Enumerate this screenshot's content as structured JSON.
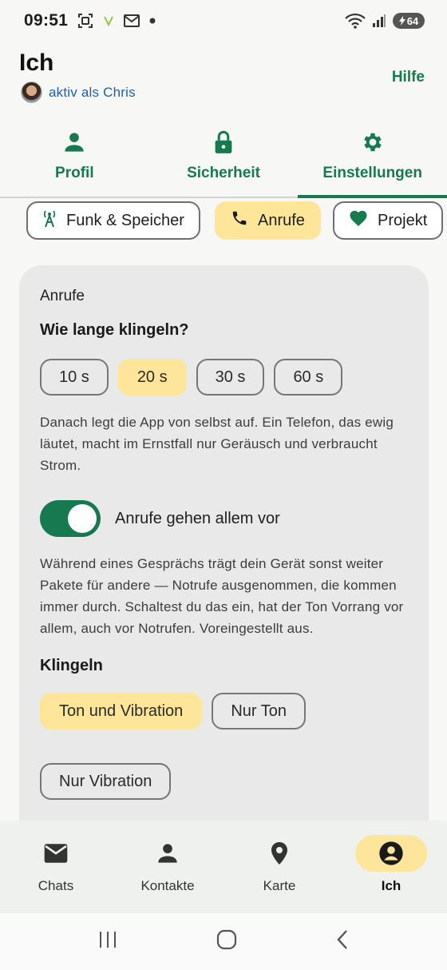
{
  "status_bar": {
    "time": "09:51",
    "battery": "64",
    "icons": [
      "screenshot-icon",
      "vpn-icon",
      "mail-icon",
      "dot-icon",
      "wifi-icon",
      "signal-icon",
      "battery-icon"
    ]
  },
  "header": {
    "title": "Ich",
    "user_status": "aktiv als Chris",
    "help_label": "Hilfe"
  },
  "tabs": [
    {
      "label": "Profil",
      "icon": "person-icon"
    },
    {
      "label": "Sicherheit",
      "icon": "lock-icon"
    },
    {
      "label": "Einstellungen",
      "icon": "gear-icon",
      "active": true
    }
  ],
  "chips": [
    {
      "label": "Funk & Speicher",
      "icon": "antenna-icon"
    },
    {
      "label": "Anrufe",
      "icon": "phone-icon",
      "selected": true
    },
    {
      "label": "Projekt",
      "icon": "heart-icon"
    }
  ],
  "calls": {
    "section_title": "Anrufe",
    "ring_duration_question": "Wie lange klingeln?",
    "ring_duration_options": [
      "10 s",
      "20 s",
      "30 s",
      "60 s"
    ],
    "ring_duration_selected": "20 s",
    "ring_duration_help": "Danach legt die App von selbst auf. Ein Telefon, das ewig läutet, macht im Ernstfall nur Geräusch und verbraucht Strom.",
    "priority_toggle_label": "Anrufe gehen allem vor",
    "priority_toggle_on": true,
    "priority_help": "Während eines Gesprächs trägt dein Gerät sonst weiter Pakete für andere — Notrufe ausgenommen, die kommen immer durch. Schaltest du das ein, hat der Ton Vorrang vor allem, auch vor Notrufen. Voreingestellt aus.",
    "ringing_title": "Klingeln",
    "ringing_options": [
      "Ton und Vibration",
      "Nur Ton",
      "Nur Vibration"
    ],
    "ringing_selected": "Ton und Vibration"
  },
  "bottom_nav": [
    {
      "label": "Chats",
      "icon": "mail-icon"
    },
    {
      "label": "Kontakte",
      "icon": "person-icon"
    },
    {
      "label": "Karte",
      "icon": "map-pin-icon"
    },
    {
      "label": "Ich",
      "icon": "account-circle-icon",
      "active": true
    }
  ],
  "colors": {
    "accent": "#16794f",
    "selected": "#fde59a",
    "link": "#1f5ea8"
  }
}
